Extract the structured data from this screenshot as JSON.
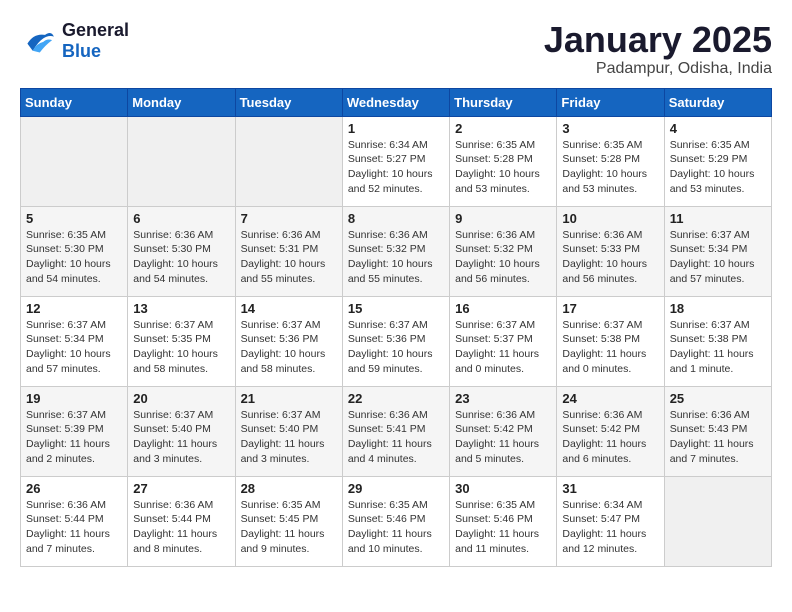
{
  "header": {
    "logo_line1": "General",
    "logo_line2": "Blue",
    "month": "January 2025",
    "location": "Padampur, Odisha, India"
  },
  "weekdays": [
    "Sunday",
    "Monday",
    "Tuesday",
    "Wednesday",
    "Thursday",
    "Friday",
    "Saturday"
  ],
  "weeks": [
    [
      {
        "day": "",
        "sunrise": "",
        "sunset": "",
        "daylight": "",
        "empty": true
      },
      {
        "day": "",
        "sunrise": "",
        "sunset": "",
        "daylight": "",
        "empty": true
      },
      {
        "day": "",
        "sunrise": "",
        "sunset": "",
        "daylight": "",
        "empty": true
      },
      {
        "day": "1",
        "sunrise": "Sunrise: 6:34 AM",
        "sunset": "Sunset: 5:27 PM",
        "daylight": "Daylight: 10 hours and 52 minutes.",
        "empty": false
      },
      {
        "day": "2",
        "sunrise": "Sunrise: 6:35 AM",
        "sunset": "Sunset: 5:28 PM",
        "daylight": "Daylight: 10 hours and 53 minutes.",
        "empty": false
      },
      {
        "day": "3",
        "sunrise": "Sunrise: 6:35 AM",
        "sunset": "Sunset: 5:28 PM",
        "daylight": "Daylight: 10 hours and 53 minutes.",
        "empty": false
      },
      {
        "day": "4",
        "sunrise": "Sunrise: 6:35 AM",
        "sunset": "Sunset: 5:29 PM",
        "daylight": "Daylight: 10 hours and 53 minutes.",
        "empty": false
      }
    ],
    [
      {
        "day": "5",
        "sunrise": "Sunrise: 6:35 AM",
        "sunset": "Sunset: 5:30 PM",
        "daylight": "Daylight: 10 hours and 54 minutes.",
        "empty": false
      },
      {
        "day": "6",
        "sunrise": "Sunrise: 6:36 AM",
        "sunset": "Sunset: 5:30 PM",
        "daylight": "Daylight: 10 hours and 54 minutes.",
        "empty": false
      },
      {
        "day": "7",
        "sunrise": "Sunrise: 6:36 AM",
        "sunset": "Sunset: 5:31 PM",
        "daylight": "Daylight: 10 hours and 55 minutes.",
        "empty": false
      },
      {
        "day": "8",
        "sunrise": "Sunrise: 6:36 AM",
        "sunset": "Sunset: 5:32 PM",
        "daylight": "Daylight: 10 hours and 55 minutes.",
        "empty": false
      },
      {
        "day": "9",
        "sunrise": "Sunrise: 6:36 AM",
        "sunset": "Sunset: 5:32 PM",
        "daylight": "Daylight: 10 hours and 56 minutes.",
        "empty": false
      },
      {
        "day": "10",
        "sunrise": "Sunrise: 6:36 AM",
        "sunset": "Sunset: 5:33 PM",
        "daylight": "Daylight: 10 hours and 56 minutes.",
        "empty": false
      },
      {
        "day": "11",
        "sunrise": "Sunrise: 6:37 AM",
        "sunset": "Sunset: 5:34 PM",
        "daylight": "Daylight: 10 hours and 57 minutes.",
        "empty": false
      }
    ],
    [
      {
        "day": "12",
        "sunrise": "Sunrise: 6:37 AM",
        "sunset": "Sunset: 5:34 PM",
        "daylight": "Daylight: 10 hours and 57 minutes.",
        "empty": false
      },
      {
        "day": "13",
        "sunrise": "Sunrise: 6:37 AM",
        "sunset": "Sunset: 5:35 PM",
        "daylight": "Daylight: 10 hours and 58 minutes.",
        "empty": false
      },
      {
        "day": "14",
        "sunrise": "Sunrise: 6:37 AM",
        "sunset": "Sunset: 5:36 PM",
        "daylight": "Daylight: 10 hours and 58 minutes.",
        "empty": false
      },
      {
        "day": "15",
        "sunrise": "Sunrise: 6:37 AM",
        "sunset": "Sunset: 5:36 PM",
        "daylight": "Daylight: 10 hours and 59 minutes.",
        "empty": false
      },
      {
        "day": "16",
        "sunrise": "Sunrise: 6:37 AM",
        "sunset": "Sunset: 5:37 PM",
        "daylight": "Daylight: 11 hours and 0 minutes.",
        "empty": false
      },
      {
        "day": "17",
        "sunrise": "Sunrise: 6:37 AM",
        "sunset": "Sunset: 5:38 PM",
        "daylight": "Daylight: 11 hours and 0 minutes.",
        "empty": false
      },
      {
        "day": "18",
        "sunrise": "Sunrise: 6:37 AM",
        "sunset": "Sunset: 5:38 PM",
        "daylight": "Daylight: 11 hours and 1 minute.",
        "empty": false
      }
    ],
    [
      {
        "day": "19",
        "sunrise": "Sunrise: 6:37 AM",
        "sunset": "Sunset: 5:39 PM",
        "daylight": "Daylight: 11 hours and 2 minutes.",
        "empty": false
      },
      {
        "day": "20",
        "sunrise": "Sunrise: 6:37 AM",
        "sunset": "Sunset: 5:40 PM",
        "daylight": "Daylight: 11 hours and 3 minutes.",
        "empty": false
      },
      {
        "day": "21",
        "sunrise": "Sunrise: 6:37 AM",
        "sunset": "Sunset: 5:40 PM",
        "daylight": "Daylight: 11 hours and 3 minutes.",
        "empty": false
      },
      {
        "day": "22",
        "sunrise": "Sunrise: 6:36 AM",
        "sunset": "Sunset: 5:41 PM",
        "daylight": "Daylight: 11 hours and 4 minutes.",
        "empty": false
      },
      {
        "day": "23",
        "sunrise": "Sunrise: 6:36 AM",
        "sunset": "Sunset: 5:42 PM",
        "daylight": "Daylight: 11 hours and 5 minutes.",
        "empty": false
      },
      {
        "day": "24",
        "sunrise": "Sunrise: 6:36 AM",
        "sunset": "Sunset: 5:42 PM",
        "daylight": "Daylight: 11 hours and 6 minutes.",
        "empty": false
      },
      {
        "day": "25",
        "sunrise": "Sunrise: 6:36 AM",
        "sunset": "Sunset: 5:43 PM",
        "daylight": "Daylight: 11 hours and 7 minutes.",
        "empty": false
      }
    ],
    [
      {
        "day": "26",
        "sunrise": "Sunrise: 6:36 AM",
        "sunset": "Sunset: 5:44 PM",
        "daylight": "Daylight: 11 hours and 7 minutes.",
        "empty": false
      },
      {
        "day": "27",
        "sunrise": "Sunrise: 6:36 AM",
        "sunset": "Sunset: 5:44 PM",
        "daylight": "Daylight: 11 hours and 8 minutes.",
        "empty": false
      },
      {
        "day": "28",
        "sunrise": "Sunrise: 6:35 AM",
        "sunset": "Sunset: 5:45 PM",
        "daylight": "Daylight: 11 hours and 9 minutes.",
        "empty": false
      },
      {
        "day": "29",
        "sunrise": "Sunrise: 6:35 AM",
        "sunset": "Sunset: 5:46 PM",
        "daylight": "Daylight: 11 hours and 10 minutes.",
        "empty": false
      },
      {
        "day": "30",
        "sunrise": "Sunrise: 6:35 AM",
        "sunset": "Sunset: 5:46 PM",
        "daylight": "Daylight: 11 hours and 11 minutes.",
        "empty": false
      },
      {
        "day": "31",
        "sunrise": "Sunrise: 6:34 AM",
        "sunset": "Sunset: 5:47 PM",
        "daylight": "Daylight: 11 hours and 12 minutes.",
        "empty": false
      },
      {
        "day": "",
        "sunrise": "",
        "sunset": "",
        "daylight": "",
        "empty": true
      }
    ]
  ]
}
